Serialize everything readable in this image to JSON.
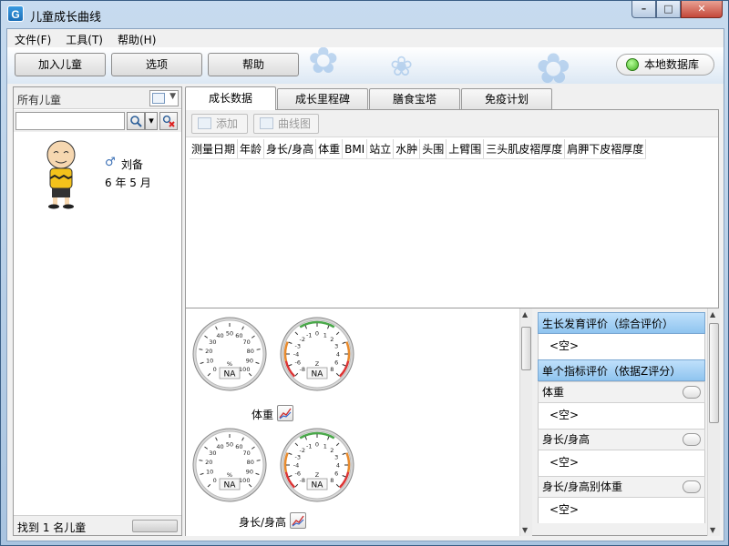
{
  "window": {
    "title": "儿童成长曲线",
    "app_icon": "G",
    "buttons": [
      "–",
      "□",
      "✕"
    ]
  },
  "menu": [
    {
      "label": "文件(F)"
    },
    {
      "label": "工具(T)"
    },
    {
      "label": "帮助(H)"
    }
  ],
  "toolbar": {
    "add_child": "加入儿童",
    "options": "选项",
    "help": "帮助",
    "db_status": "本地数据库",
    "db_status_color": "#3fae1e"
  },
  "left": {
    "filter_label": "所有儿童",
    "search_placeholder": "",
    "children": [
      {
        "name": "刘备",
        "gender": "male",
        "age": "6 年 5 月"
      }
    ],
    "footer": "找到 1 名儿童"
  },
  "tabs": [
    {
      "label": "成长数据",
      "active": true
    },
    {
      "label": "成长里程碑"
    },
    {
      "label": "膳食宝塔"
    },
    {
      "label": "免疫计划"
    }
  ],
  "pane": {
    "add_button": "添加",
    "chart_button": "曲线图",
    "columns": [
      "测量日期",
      "年龄",
      "身长/身高",
      "体重",
      "BMI",
      "站立",
      "水肿",
      "头围",
      "上臂围",
      "三头肌皮褶厚度",
      "肩胛下皮褶厚度"
    ]
  },
  "gauges": {
    "percentile_ticks": [
      "0",
      "10",
      "20",
      "30",
      "40",
      "50",
      "60",
      "70",
      "80",
      "90",
      "100"
    ],
    "percentile_unit": "%",
    "z_ticks": [
      "-8",
      "-6",
      "-4",
      "-3",
      "-2",
      "-1",
      "0",
      "1",
      "2",
      "3",
      "4",
      "6",
      "8"
    ],
    "z_unit": "Z",
    "value": "NA",
    "rows": [
      {
        "label": "体重"
      },
      {
        "label": "身长/身高"
      }
    ]
  },
  "evaluation": {
    "overall_title": "生长发育评价（综合评价）",
    "overall_value": "<空>",
    "single_title": "单个指标评价（依据Z评分）",
    "items": [
      {
        "label": "体重",
        "value": "<空>"
      },
      {
        "label": "身长/身高",
        "value": "<空>"
      },
      {
        "label": "身长/身高别体重",
        "value": "<空>"
      }
    ]
  }
}
